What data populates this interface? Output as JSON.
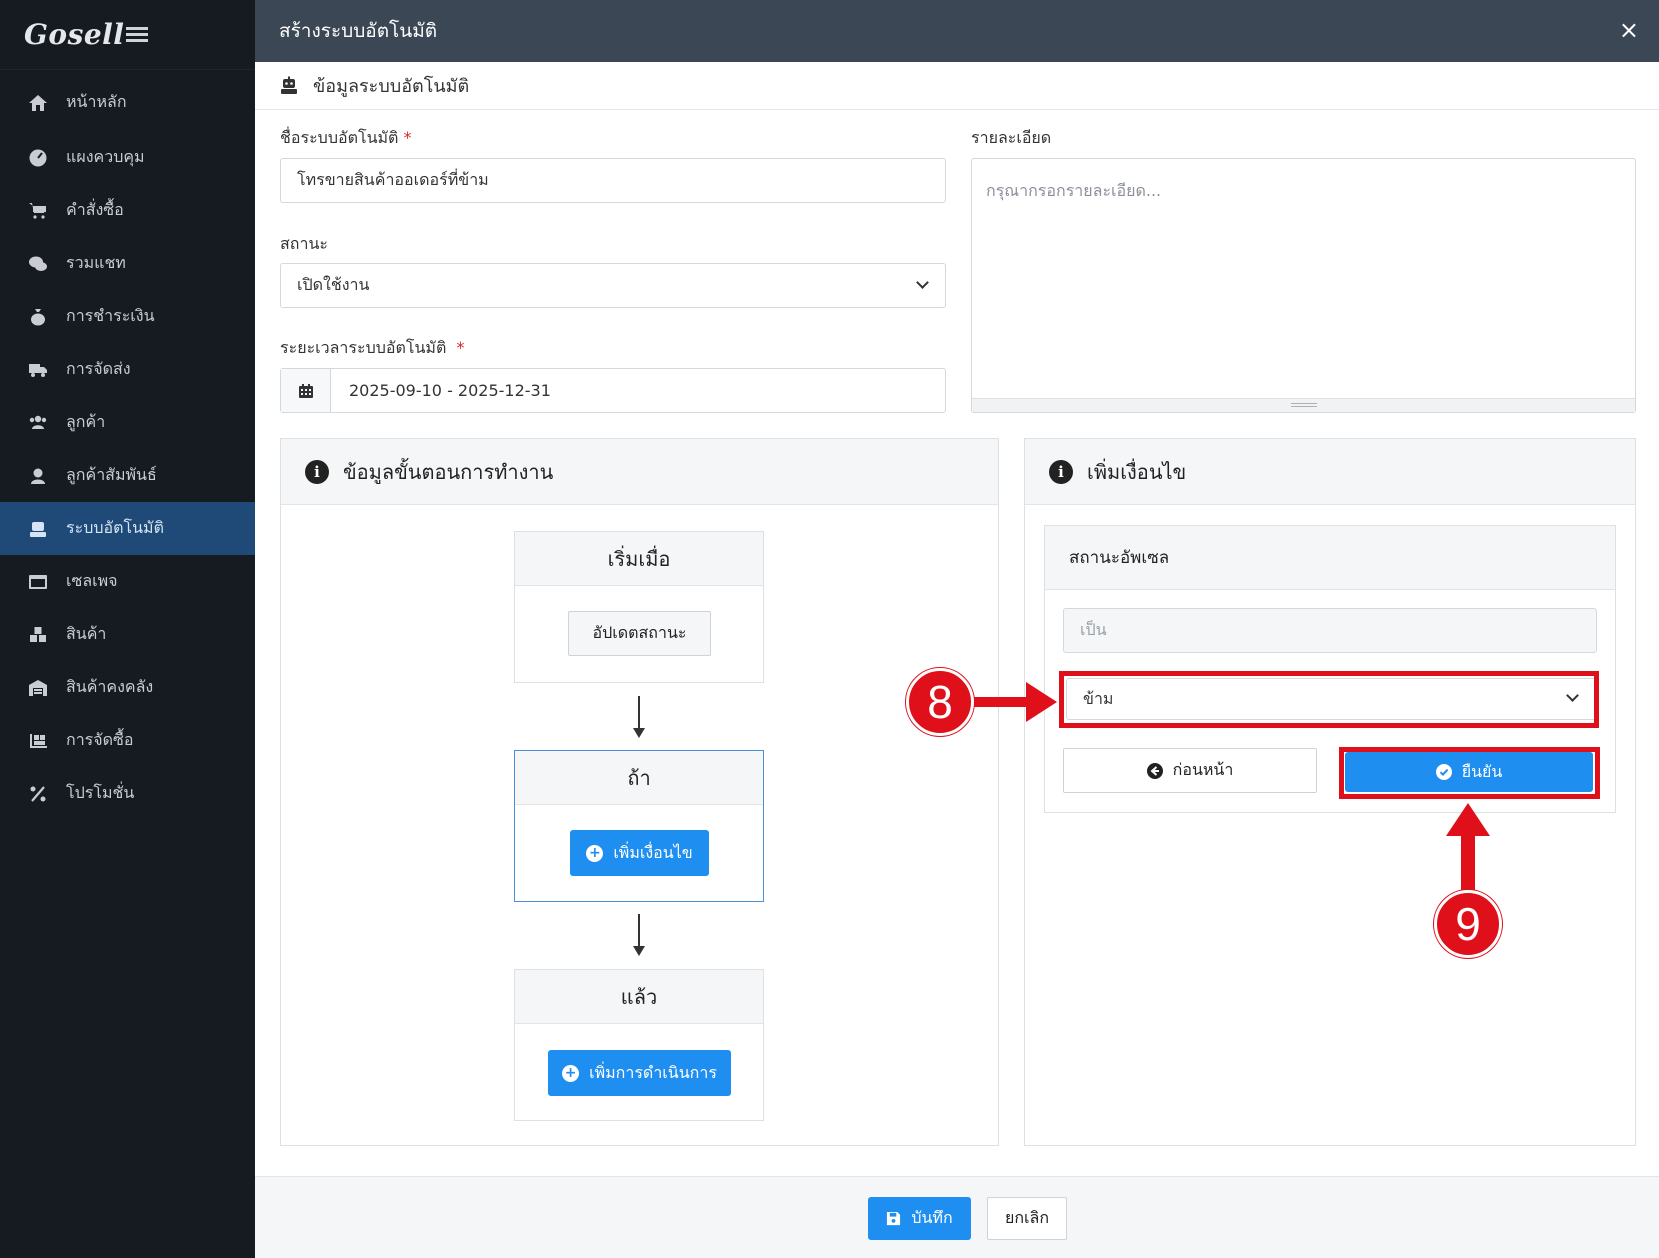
{
  "app": {
    "logo": "Gosell"
  },
  "sidebar": {
    "items": [
      {
        "label": "หน้าหลัก",
        "icon": "home-icon",
        "active": false
      },
      {
        "label": "แผงควบคุม",
        "icon": "dashboard-icon",
        "active": false
      },
      {
        "label": "คำสั่งซื้อ",
        "icon": "cart-icon",
        "active": false
      },
      {
        "label": "รวมแชท",
        "icon": "chat-icon",
        "active": false
      },
      {
        "label": "การชำระเงิน",
        "icon": "money-bag-icon",
        "active": false
      },
      {
        "label": "การจัดส่ง",
        "icon": "truck-icon",
        "active": false
      },
      {
        "label": "ลูกค้า",
        "icon": "users-icon",
        "active": false
      },
      {
        "label": "ลูกค้าสัมพันธ์",
        "icon": "support-agent-icon",
        "active": false
      },
      {
        "label": "ระบบอัตโนมัติ",
        "icon": "robot-icon",
        "active": true
      },
      {
        "label": "เซลเพจ",
        "icon": "window-icon",
        "active": false
      },
      {
        "label": "สินค้า",
        "icon": "boxes-icon",
        "active": false
      },
      {
        "label": "สินค้าคงคลัง",
        "icon": "warehouse-icon",
        "active": false
      },
      {
        "label": "การจัดซื้อ",
        "icon": "pallet-icon",
        "active": false
      },
      {
        "label": "โปรโมชั่น",
        "icon": "percent-icon",
        "active": false
      }
    ]
  },
  "modal": {
    "title": "สร้างระบบอัตโนมัติ",
    "close": "×",
    "section_title": "ข้อมูลระบบอัตโนมัติ",
    "form": {
      "name_label": "ชื่อระบบอัตโนมัติ",
      "required_mark": "*",
      "name_value": "โทรขายสินค้าออเดอร์ที่ข้าม",
      "status_label": "สถานะ",
      "status_value": "เปิดใช้งาน",
      "period_label": "ระยะเวลาระบบอัตโนมัติ",
      "period_value": "2025-09-10 - 2025-12-31",
      "detail_label": "รายละเอียด",
      "detail_placeholder": "กรุณากรอกรายละเอียด..."
    },
    "workflow": {
      "title": "ข้อมูลขั้นตอนการทำงาน",
      "start_title": "เริ่มเมื่อ",
      "start_button": "อัปเดตสถานะ",
      "if_title": "ถ้า",
      "if_button": "เพิ่มเงื่อนไข",
      "then_title": "แล้ว",
      "then_button": "เพิ่มการดำเนินการ"
    },
    "condition": {
      "title": "เพิ่มเงื่อนไข",
      "box_title": "สถานะอัพเซล",
      "operator_placeholder": "เป็น",
      "value_selected": "ข้าม",
      "back_button": "ก่อนหน้า",
      "confirm_button": "ยืนยัน"
    },
    "footer": {
      "save_button": "บันทึก",
      "cancel_button": "ยกเลิก"
    }
  },
  "annotations": {
    "step_8": "8",
    "step_9": "9",
    "color": "#e0101a"
  }
}
